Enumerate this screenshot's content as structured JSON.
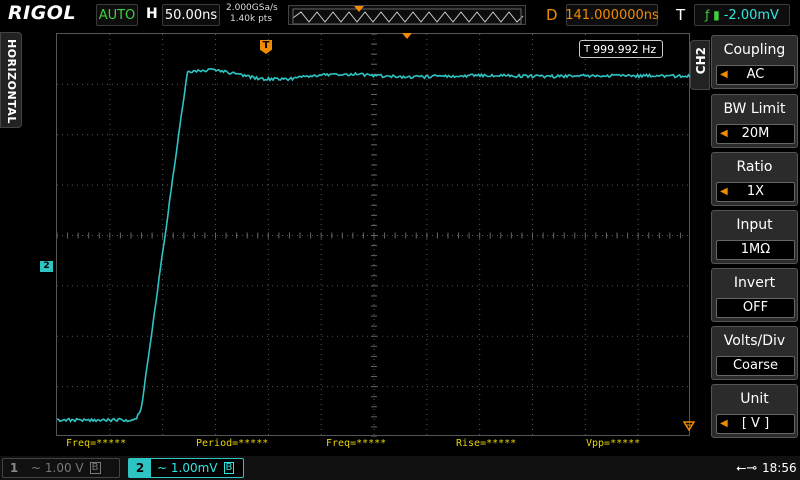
{
  "brand": {
    "logo": "RIGOL"
  },
  "top": {
    "trigger_mode": "AUTO",
    "h_label": "H",
    "timebase": "50.00ns",
    "sample_rate": "2.000GSa/s",
    "memory_depth": "1.40k pts",
    "d_label": "D",
    "delay": "141.000000ns",
    "t_label": "T",
    "trigger_source_icon": "edge-trigger-icon",
    "trigger_level": "-2.00mV"
  },
  "left_tab": {
    "label": "HORIZONTAL"
  },
  "screen": {
    "frequency_counter": "999.992 Hz",
    "trigger_position_marker": "T",
    "channel_marker": "2"
  },
  "measurements": [
    {
      "label": "Freq=*****"
    },
    {
      "label": "Period=*****"
    },
    {
      "label": "Freq=*****"
    },
    {
      "label": "Rise=*****"
    },
    {
      "label": "Vpp=*****"
    }
  ],
  "right_panel": {
    "channel_tab": "CH2",
    "items": [
      {
        "label": "Coupling",
        "value": "AC"
      },
      {
        "label": "BW Limit",
        "value": "20M"
      },
      {
        "label": "Ratio",
        "value": "1X"
      },
      {
        "label": "Input",
        "value": "1MΩ"
      },
      {
        "label": "Invert",
        "value": "OFF"
      },
      {
        "label": "Volts/Div",
        "value": "Coarse"
      },
      {
        "label": "Unit",
        "value": "[  V  ]"
      }
    ]
  },
  "bottom": {
    "ch1": {
      "num": "1",
      "scale": "~ 1.00 V"
    },
    "ch2": {
      "num": "2",
      "scale": "~ 1.00mV"
    },
    "time": "18:56"
  },
  "colors": {
    "ch2": "#2ec4c4",
    "accent_orange": "#f08a00",
    "auto_green": "#3fd13f",
    "measure_yellow": "#e8d400"
  }
}
